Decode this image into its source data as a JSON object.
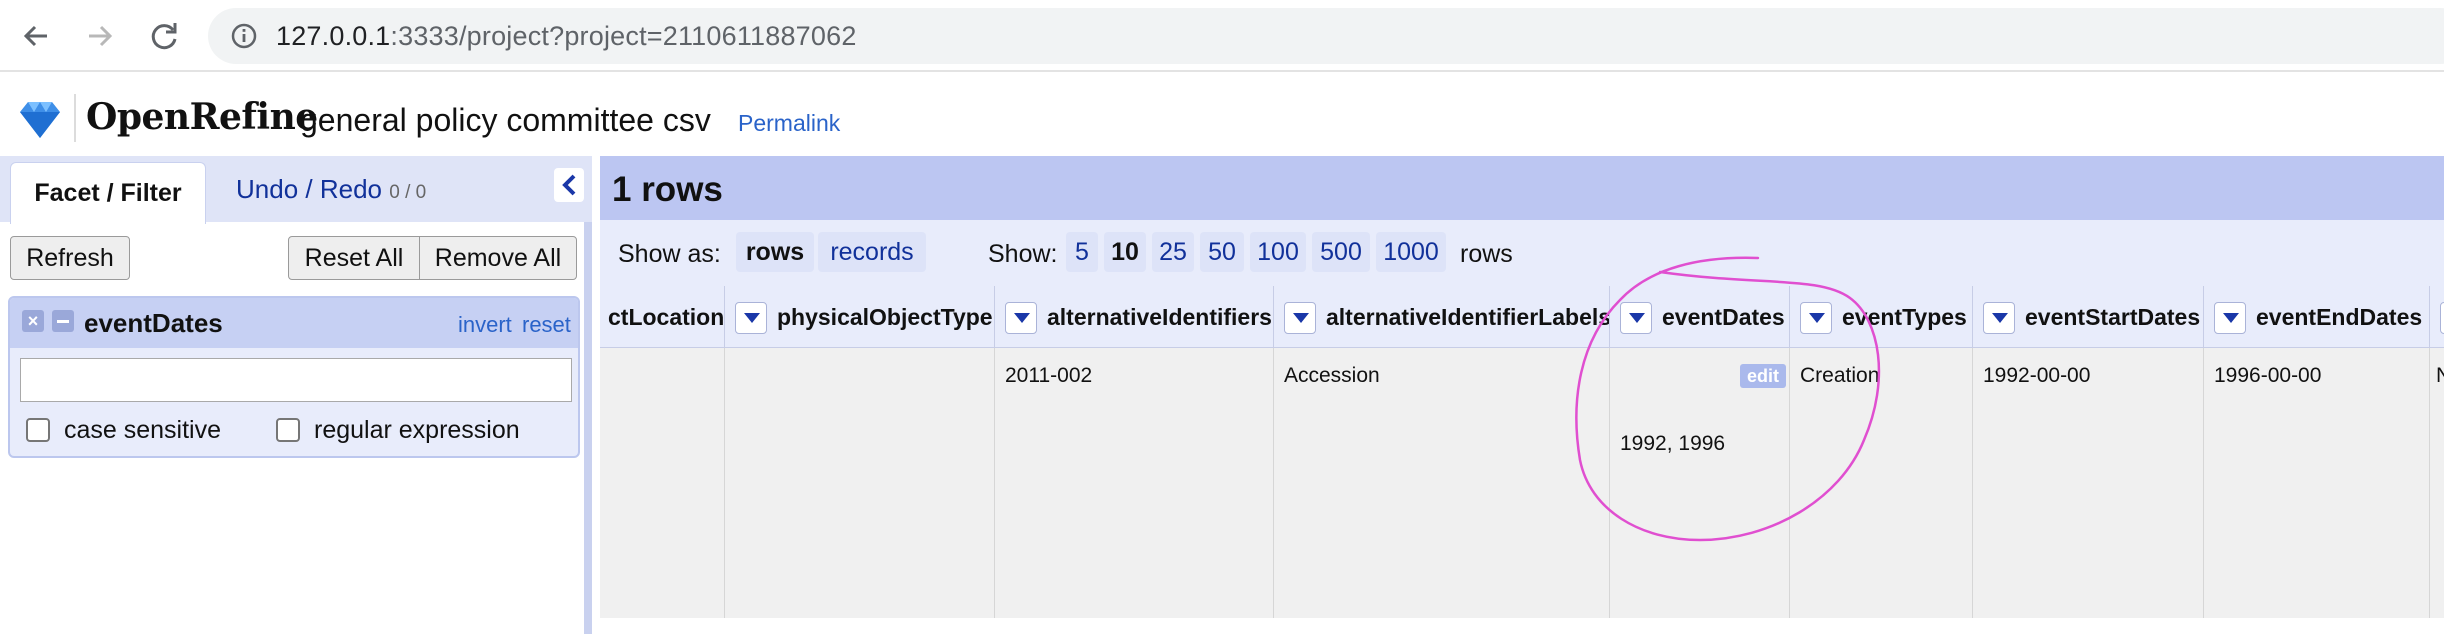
{
  "browser": {
    "url_host": "127.0.0.1",
    "url_rest": ":3333/project?project=2110611887062"
  },
  "app": {
    "logo_text": "OpenRefine",
    "project_name": "general policy committee csv",
    "permalink": "Permalink"
  },
  "left": {
    "tab_facet": "Facet / Filter",
    "tab_undo": "Undo / Redo",
    "tab_undo_count": "0 / 0",
    "refresh": "Refresh",
    "reset_all": "Reset All",
    "remove_all": "Remove All",
    "facet": {
      "close": "×",
      "title": "eventDates",
      "invert": "invert",
      "reset": "reset",
      "search_value": "",
      "case_sensitive": "case sensitive",
      "regular_expression": "regular expression"
    }
  },
  "grid": {
    "rows_title": "1 rows",
    "show_as_label": "Show as:",
    "show_as_rows": "rows",
    "show_as_records": "records",
    "show_label": "Show:",
    "page_sizes": [
      "5",
      "10",
      "25",
      "50",
      "100",
      "500",
      "1000"
    ],
    "selected_page_size": "10",
    "rows_suffix": "rows",
    "columns": [
      "ctLocation",
      "physicalObjectType",
      "alternativeIdentifiers",
      "alternativeIdentifierLabels",
      "eventDates",
      "eventTypes",
      "eventStartDates",
      "eventEndDates"
    ],
    "row": {
      "ctLocation": "",
      "physicalObjectType": "",
      "alternativeIdentifiers": "2011-002",
      "alternativeIdentifierLabels": "Accession",
      "eventDates": "1992, 1996",
      "eventDates_edit": "edit",
      "eventTypes": "Creation",
      "eventStartDates": "1992-00-00",
      "eventEndDates": "1996-00-00",
      "next_col_partial": "N"
    }
  },
  "colors": {
    "accent_header": "#bcc6f2",
    "link_blue": "#2a63c9",
    "annotation": "#e04fd0"
  }
}
